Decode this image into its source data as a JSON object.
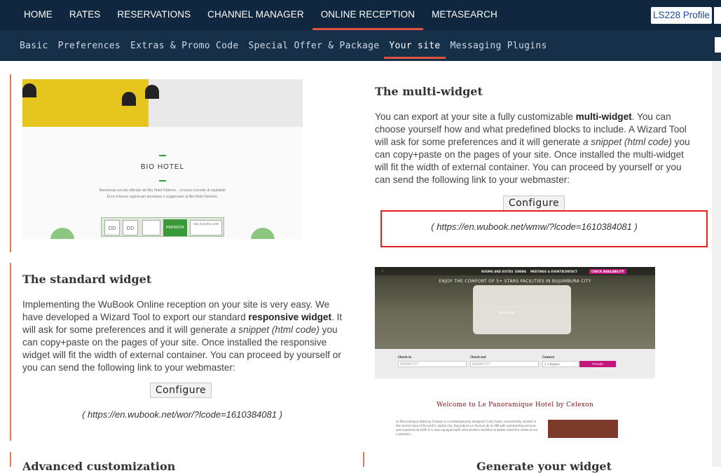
{
  "top_nav": {
    "items": [
      "HOME",
      "RATES",
      "RESERVATIONS",
      "CHANNEL MANAGER",
      "ONLINE RECEPTION",
      "METASEARCH"
    ],
    "active_index": 4,
    "profile_label": "LS228 Profile"
  },
  "sub_nav": {
    "items": [
      "Basic",
      "Preferences",
      "Extras & Promo Code",
      "Special Offer & Package",
      "Your site",
      "Messaging Plugins"
    ],
    "active_index": 4
  },
  "multi_widget": {
    "title": "The multi-widget",
    "p1": "You can export at your site a fully customizable ",
    "b1": "multi-widget",
    "p2": ". You can choose yourself how and what predefined blocks to include. A Wizard Tool will ask for some preferences and it will generate ",
    "i1": "a snippet (html code)",
    "p3": " you can copy+paste on the pages of your site. Once installed the multi-widget will fit the width of external container. You can proceed by yourself or you can send the following link to your webmaster:",
    "configure_label": "Configure",
    "link": "( https://en.wubook.net/wmw/?lcode=1610384081 )"
  },
  "standard_widget": {
    "title": "The standard widget",
    "p1": "Implementing the WuBook Online reception on your site is very easy. We have developed a Wizard Tool to export our standard ",
    "b1": "responsive widget",
    "p2": ". It will ask for some preferences and it will generate ",
    "i1": "a snippet (html code)",
    "p3": " you can copy+paste on the pages of your site. Once installed the responsive widget will fit the width of external container. You can proceed by yourself or you can send the following link to your webmaster:",
    "configure_label": "Configure",
    "link": "( https://en.wubook.net/wor/?lcode=1610384081 )"
  },
  "bottom": {
    "left_title": "Advanced customization",
    "right_title": "Generate your widget"
  },
  "preview_bio_hotel": {
    "title": "BIO HOTEL",
    "line1": "Benvenuto nel sito ufficiale del Bio Hotel Palermo... il nuovo concetto di ospitalità!",
    "line2": "Ecco 4 buone ragioni per prenotare e soggiornare al Bio Hotel Palermo.",
    "fields": [
      "DD",
      "DD"
    ],
    "button": "PRENOTA",
    "promo": "Usa il promo code"
  },
  "preview_panoramique": {
    "nav_items": [
      "ROOMS AND SUITES",
      "DINING",
      "MEETINGS & EVENTS",
      "CONTACT",
      "CHECK AVAILABILITY"
    ],
    "hero_text": "ENJOY THE COMFORT OF 5+ STARS FACILITIES IN BUJUMBURA CITY",
    "book_now": "BOOK NOW",
    "checkin_label": "Check-in",
    "checkout_label": "Check-out",
    "rooms_label": "Camere",
    "date_placeholder": "DD/MM/YYYY",
    "rooms_value": "1 x Doppia",
    "button": "Prenota",
    "welcome": "Welcome to Le Panoramique Hotel by Celexon",
    "body": "Le Panoramique Hotel by Celexon is a contemporarily designed 5 star hotel, conveniently located in the central area of Burundi's capital city, Bujumbura on Avenue de la ONI with outstanding services and experienced staff. It is also equipped with ultra-modern facilities to better meet the needs of our customers."
  }
}
